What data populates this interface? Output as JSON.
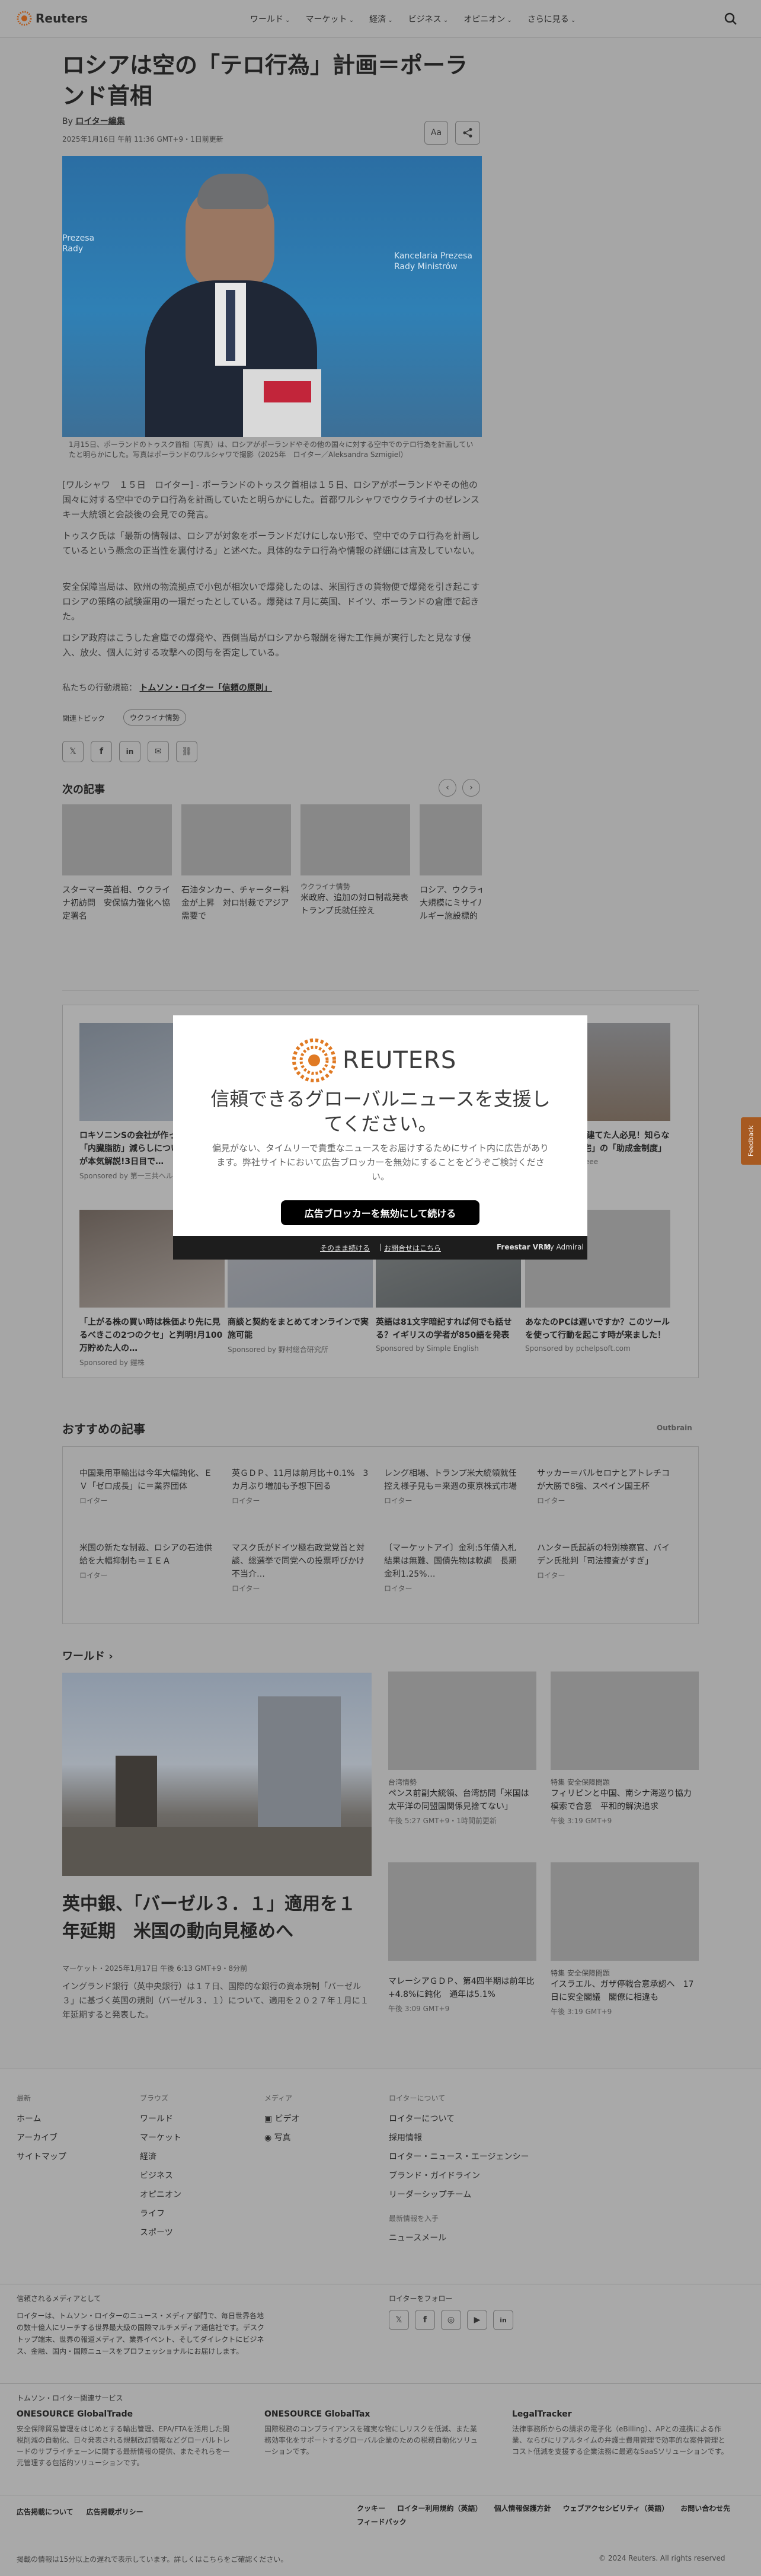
{
  "header": {
    "logo": "Reuters",
    "nav": [
      "ワールド",
      "マーケット",
      "経済",
      "ビジネス",
      "オピニオン",
      "さらに見る"
    ]
  },
  "article": {
    "title": "ロシアは空の「テロ行為」計画＝ポーランド首相",
    "byline_prefix": "By",
    "byline": "ロイター編集",
    "date": "2025年1月16日 午前 11:36 GMT+9・1日前更新",
    "caption": "1月15日、ポーランドのトゥスク首相（写真）は、ロシアがポーランドやその他の国々に対する空中でのテロ行為を計画していたと明らかにした。写真はポーランドのワルシャワで撮影（2025年　ロイター／Aleksandra Szmigiel）",
    "paragraphs": [
      "[ワルシャワ　１５日　ロイター] - ポーランドのトゥスク首相は１５日、ロシアがポーランドやその他の国々に対する空中でのテロ行為を計画していたと明らかにした。首都ワルシャワでウクライナのゼレンスキー大統領と会談後の会見での発言。",
      "トゥスク氏は「最新の情報は、ロシアが対象をポーランドだけにしない形で、空中でのテロ行為を計画しているという懸念の正当性を裏付ける」と述べた。具体的なテロ行為や情報の詳細には言及していない。",
      "安全保障当局は、欧州の物流拠点で小包が相次いで爆発したのは、米国行きの貨物便で爆発を引き起こすロシアの策略の試験運用の一環だったとしている。爆発は７月に英国、ドイツ、ポーランドの倉庫で起きた。",
      "ロシア政府はこうした倉庫での爆発や、西側当局がロシアから報酬を得た工作員が実行したと見なす侵入、放火、個人に対する攻撃への関与を否定している。"
    ],
    "standards_prefix": "私たちの行動規範：",
    "standards_link": "トムソン・ロイター「信頼の原則」",
    "topics_label": "関連トピック",
    "topic": "ウクライナ情勢",
    "font_btn": "Aa"
  },
  "next": {
    "label": "次の記事",
    "items": [
      {
        "tag": "",
        "title": "スターマー英首相、ウクライナ初訪問　安保協力強化へ協定署名"
      },
      {
        "tag": "",
        "title": "石油タンカー、チャーター料金が上昇　対ロ制裁でアジア需要で"
      },
      {
        "tag": "ウクライナ情勢",
        "title": "米政府、追加の対ロ制裁発表　トランプ氏就任控え"
      },
      {
        "tag": "",
        "title": "ロシア、ウクライナ防衛網を大規模にミサイル攻撃　エネルギー施設標的"
      }
    ]
  },
  "sponsored": [
    {
      "title": "ロキソニンSの会社が作った最強の「内臓脂肪」減らしについて中年男性が本気解説!3日目で…",
      "by": "Sponsored by 第一三共ヘルスケア"
    },
    {
      "title": "",
      "by": ""
    },
    {
      "title": "",
      "by": ""
    },
    {
      "title": "30年以上前に家建てた人必見！知らないと損する「住宅」の「助成金制度」",
      "by": "Sponsored by Speee"
    },
    {
      "title": "「上がる株の買い時は株価より先に見るべきこの2つのクセ」と判明!月100万貯めた人の…",
      "by": "Sponsored by 鎧株"
    },
    {
      "title": "商談と契約をまとめてオンラインで実施可能",
      "by": "Sponsored by 野村総合研究所"
    },
    {
      "title": "英語は81文字暗記すれば何でも話せる？イギリスの学者が850語を発表",
      "by": "Sponsored by Simple English"
    },
    {
      "title": "あなたのPCは遅いですか？このツールを使って行動を起こす時が来ました！",
      "by": "Sponsored by pchelpsoft.com"
    }
  ],
  "modal": {
    "logo": "REUTERS",
    "heading": "信頼できるグローバルニュースを支援してください。",
    "body": "偏見がない、タイムリーで貴重なニュースをお届けするためにサイト内に広告があります。弊社サイトにおいて広告ブロッカーを無効にすることをどうぞご検討ください。",
    "cta": "広告ブロッカーを無効にして続ける",
    "link1": "そのまま続ける",
    "link2": "お問合せはこちら",
    "brand": "Freestar VRM",
    "brand2": "by Admiral"
  },
  "recommended": {
    "label": "おすすめの記事",
    "brand": "Outbrain",
    "items": [
      {
        "title": "中国乗用車輸出は今年大幅鈍化、ＥＶ「ゼロ成長」に＝業界団体",
        "src": "ロイター"
      },
      {
        "title": "英ＧＤＰ、11月は前月比＋0.1%　3カ月ぶり増加も予想下回る",
        "src": "ロイター"
      },
      {
        "title": "レング相場、トランプ米大統領就任控え様子見も＝来週の東京株式市場",
        "src": "ロイター"
      },
      {
        "title": "サッカー＝バルセロナとアトレチコが大勝で8強、スペイン国王杯",
        "src": "ロイター"
      },
      {
        "title": "米国の新たな制裁、ロシアの石油供給を大幅抑制も＝ＩＥＡ",
        "src": "ロイター"
      },
      {
        "title": "マスク氏がドイツ極右政党党首と対談、総選挙で同党への投票呼びかけ　不当介…",
        "src": "ロイター"
      },
      {
        "title": "〔マーケットアイ〕金利:5年債入札結果は無難、国債先物は軟調　長期金利1.25%…",
        "src": "ロイター"
      },
      {
        "title": "ハンター氏起訴の特別検察官、バイデン氏批判「司法捜査がすぎ」",
        "src": "ロイター"
      }
    ]
  },
  "world": {
    "label": "ワールド",
    "main_title": "英中銀、「バーゼル３．１」適用を１年延期　米国の動向見極めへ",
    "main_meta": "マーケット・2025年1月17日 午後 6:13 GMT+9・8分前",
    "main_desc": "イングランド銀行（英中央銀行）は１７日、国際的な銀行の資本規制「バーゼル３」に基づく英国の規則（バーゼル３．１）について、適用を２０２７年１月に１年延期すると発表した。",
    "side": [
      {
        "tag": "台湾情勢",
        "title": "ペンス前副大統領、台湾訪問「米国は太平洋の同盟国関係見捨てない」",
        "time": "午後 5:27 GMT+9・1時間前更新"
      },
      {
        "tag": "特集 安全保障問題",
        "title": "フィリピンと中国、南シナ海巡り協力模索で合意　平和的解決追求",
        "time": "午後 3:19 GMT+9"
      },
      {
        "tag": "",
        "title": "マレーシアＧＤＰ、第4四半期は前年比+4.8%に鈍化　通年は5.1%",
        "time": "午後 3:09 GMT+9"
      },
      {
        "tag": "特集 安全保障問題",
        "title": "イスラエル、ガザ停戦合意承認へ　17日に安全閣議　閣僚に相違も",
        "time": "午後 3:19 GMT+9"
      }
    ]
  },
  "footer": {
    "cols": [
      {
        "head": "最新",
        "items": [
          "ホーム",
          "アーカイブ",
          "サイトマップ"
        ]
      },
      {
        "head": "ブラウズ",
        "items": [
          "ワールド",
          "マーケット",
          "経済",
          "ビジネス",
          "オピニオン",
          "ライフ",
          "スポーツ"
        ]
      },
      {
        "head": "メディア",
        "items": [
          "ビデオ",
          "写真"
        ]
      },
      {
        "head": "ロイターについて",
        "items": [
          "ロイターについて",
          "採用情報",
          "ロイター・ニュース・エージェンシー",
          "ブランド・ガイドライン",
          "リーダーシップチーム"
        ]
      }
    ],
    "news_head": "最新情報を入手",
    "news_item": "ニュースメール",
    "trusted_head": "信頼されるメディアとして",
    "trusted_text": "ロイターは、トムソン・ロイターのニュース・メディア部門で、毎日世界各地の数十億人にリーチする世界最大級の国際マルチメディア通信社です。デスクトップ端末、世界の報道メディア、業界イベント、そしてダイレクトにビジネス、金融、国内・国際ニュースをプロフェッショナルにお届けします。",
    "follow_head": "ロイターをフォロー",
    "services_head": "トムソン・ロイター関連サービス",
    "services": [
      {
        "name": "ONESOURCE GlobalTrade",
        "desc": "安全保障貿易管理をはじめとする輸出管理、EPA/FTAを活用した関税削減の自動化、日々発表される規制改訂情報などグローバルトレードのサプライチェーンに関する最新情報の提供、またそれらを一元管理する包括的ソリューションです。"
      },
      {
        "name": "ONESOURCE GlobalTax",
        "desc": "国際税務のコンプライアンスを確実な物にしリスクを低減、また業務効率化をサポートするグローバル企業のための税務自動化ソリューションです。"
      },
      {
        "name": "LegalTracker",
        "desc": "法律事務所からの請求の電子化（eBilling）、APとの連携による作業、ならびにリアルタイムの弁護士費用管理で効率的な案件管理とコスト低減を支援する企業法務に最適なSaaSソリューションです。"
      }
    ],
    "bottom_links": [
      "広告掲載について",
      "広告掲載ポリシー",
      "クッキー",
      "ロイター利用規約（英語）",
      "個人情報保護方針",
      "ウェブアクセシビリティ（英語）",
      "お問い合わせ先",
      "フィードバック"
    ],
    "delay": "掲載の情報は15分以上の遅れで表示しています。詳しくはこちらをご確認ください。",
    "copyright": "© 2024 Reuters. All rights reserved",
    "feedback_tab": "Feedback"
  }
}
